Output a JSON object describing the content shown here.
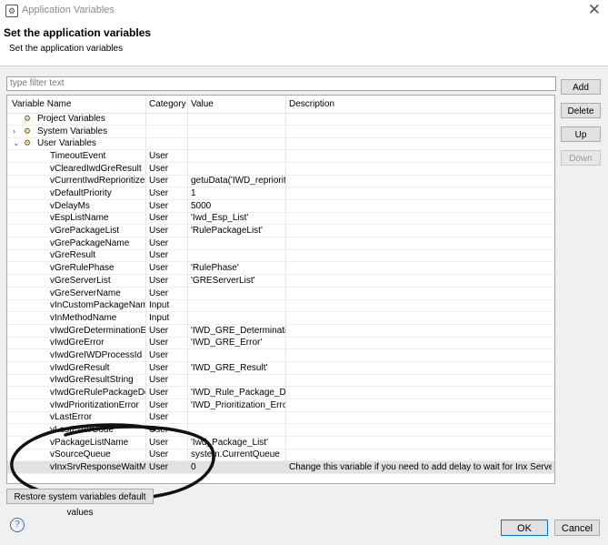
{
  "window": {
    "title": "Application Variables"
  },
  "header": {
    "title": "Set the application variables",
    "subtitle": "Set the application variables"
  },
  "filter": {
    "placeholder": "type filter text",
    "value": ""
  },
  "buttons": {
    "add": "Add",
    "delete": "Delete",
    "up": "Up",
    "down": "Down"
  },
  "table": {
    "columns": [
      "Variable Name",
      "Category",
      "Value",
      "Description"
    ],
    "groups": [
      {
        "label": "Project Variables",
        "icon": "variables-icon",
        "expanded": false,
        "has_children": false
      },
      {
        "label": "System Variables",
        "icon": "variables-gear-icon",
        "expanded": false,
        "has_children": true
      },
      {
        "label": "User Variables",
        "icon": "variables-gear-icon",
        "expanded": true,
        "has_children": true
      }
    ],
    "rows": [
      {
        "name": "TimeoutEvent",
        "category": "User",
        "value": "",
        "description": ""
      },
      {
        "name": "vClearedIwdGreResult",
        "category": "User",
        "value": "",
        "description": ""
      },
      {
        "name": "vCurrentIwdReprioritizeDa",
        "category": "User",
        "value": "getuData('IWD_repriorit...",
        "description": ""
      },
      {
        "name": "vDefaultPriority",
        "category": "User",
        "value": "1",
        "description": ""
      },
      {
        "name": "vDelayMs",
        "category": "User",
        "value": "5000",
        "description": ""
      },
      {
        "name": "vEspListName",
        "category": "User",
        "value": "'Iwd_Esp_List'",
        "description": ""
      },
      {
        "name": "vGrePackageList",
        "category": "User",
        "value": "'RulePackageList'",
        "description": ""
      },
      {
        "name": "vGrePackageName",
        "category": "User",
        "value": "",
        "description": ""
      },
      {
        "name": "vGreResult",
        "category": "User",
        "value": "",
        "description": ""
      },
      {
        "name": "vGreRulePhase",
        "category": "User",
        "value": "'RulePhase'",
        "description": ""
      },
      {
        "name": "vGreServerList",
        "category": "User",
        "value": "'GREServerList'",
        "description": ""
      },
      {
        "name": "vGreServerName",
        "category": "User",
        "value": "",
        "description": ""
      },
      {
        "name": "vInCustomPackageName",
        "category": "Input",
        "value": "",
        "description": ""
      },
      {
        "name": "vInMethodName",
        "category": "Input",
        "value": "",
        "description": ""
      },
      {
        "name": "vIwdGreDeterminationErrc",
        "category": "User",
        "value": "'IWD_GRE_Determinatio...",
        "description": ""
      },
      {
        "name": "vIwdGreError",
        "category": "User",
        "value": "'IWD_GRE_Error'",
        "description": ""
      },
      {
        "name": "vIwdGreIWDProcessId",
        "category": "User",
        "value": "",
        "description": ""
      },
      {
        "name": "vIwdGreResult",
        "category": "User",
        "value": "'IWD_GRE_Result'",
        "description": ""
      },
      {
        "name": "vIwdGreResultString",
        "category": "User",
        "value": "",
        "description": ""
      },
      {
        "name": "vIwdGreRulePackageDeter",
        "category": "User",
        "value": "'IWD_Rule_Package_Det...",
        "description": ""
      },
      {
        "name": "vIwdPrioritizationError",
        "category": "User",
        "value": "'IWD_Prioritization_Error'",
        "description": ""
      },
      {
        "name": "vLastError",
        "category": "User",
        "value": "",
        "description": ""
      },
      {
        "name": "vLastErrorCode",
        "category": "User",
        "value": "",
        "description": ""
      },
      {
        "name": "vPackageListName",
        "category": "User",
        "value": "'Iwd_Package_List'",
        "description": ""
      },
      {
        "name": "vSourceQueue",
        "category": "User",
        "value": "system.CurrentQueue",
        "description": ""
      },
      {
        "name": "vInxSrvResponseWaitMs",
        "category": "User",
        "value": "0",
        "description": "Change this variable if you need to add delay to wait for Inx Server re...",
        "selected": true
      }
    ]
  },
  "footer": {
    "restore": "Restore system variables default values",
    "ok": "OK",
    "cancel": "Cancel",
    "help": "?"
  },
  "colors": {
    "selected_row": "#e2e2e2",
    "default_button_border": "#0078d7"
  }
}
